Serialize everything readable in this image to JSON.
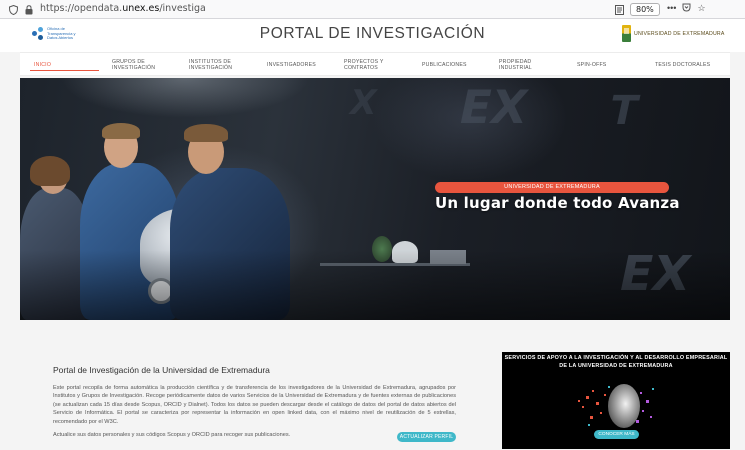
{
  "browser": {
    "url_prefix": "https://opendata.",
    "url_domain": "unex.es",
    "url_path": "/investiga",
    "zoom": "80%"
  },
  "header": {
    "title": "PORTAL DE INVESTIGACIÓN",
    "logo_left_text": "Oficina de Transparencia y Datos Abiertos",
    "logo_right_text": "UNIVERSIDAD DE EXTREMADURA"
  },
  "nav": {
    "items": [
      {
        "label": "INICIO"
      },
      {
        "label": "GRUPOS DE INVESTIGACIÓN"
      },
      {
        "label": "INSTITUTOS DE INVESTIGACIÓN"
      },
      {
        "label": "INVESTIGADORES"
      },
      {
        "label": "PROYECTOS Y CONTRATOS"
      },
      {
        "label": "PUBLICACIONES"
      },
      {
        "label": "PROPIEDAD INDUSTRIAL"
      },
      {
        "label": "SPIN-OFFS"
      },
      {
        "label": "TESIS DOCTORALES"
      }
    ],
    "active": "INICIO"
  },
  "hero": {
    "badge": "UNIVERSIDAD DE EXTREMADURA",
    "headline": "Un lugar donde todo Avanza"
  },
  "intro": {
    "title": "Portal de Investigación de la Universidad de Extremadura",
    "paragraph": "Este portal recopila de forma automática la producción científica y de transferencia de los investigadores de la Universidad de Extremadura, agrupados por Institutos y Grupos de Investigación. Recoge periódicamente datos de varios Servicios de la Universidad de Extremadura y de fuentes externas de publicaciones (se actualizan cada 15 días desde Scopus, ORCID y Dialnet). Todos los datos se pueden descargar desde el catálogo de datos del portal de datos abiertos del Servicio de Informática. El portal se caracteriza por representar la información en open linked data, con el máximo nivel de reutilización de 5 estrellas, recomendado por el W3C.",
    "update_text": "Actualice sus datos personales y sus códigos Scopus y ORCID para recoger sus publicaciones.",
    "update_button": "ACTUALIZAR PERFIL"
  },
  "promo": {
    "title": "SERVICIOS DE APOYO A LA INVESTIGACIÓN Y AL DESARROLLO EMPRESARIAL DE LA UNIVERSIDAD DE EXTREMADURA",
    "button": "CONOCER MÁS"
  },
  "colors": {
    "accent": "#e8553e",
    "button": "#3fb8c9"
  }
}
